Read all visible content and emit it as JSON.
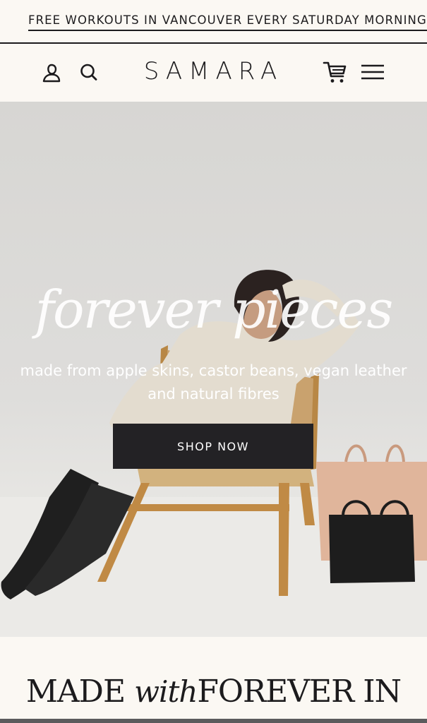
{
  "announcement": {
    "text": "FREE WORKOUTS IN VANCOUVER EVERY SATURDAY MORNING"
  },
  "header": {
    "logo": "SAMARA",
    "icons": {
      "account": "user-icon",
      "search": "search-icon",
      "cart": "cart-icon",
      "menu": "hamburger-menu-icon"
    }
  },
  "hero": {
    "title": "forever pieces",
    "subtitle": "made from apple skins, castor beans, vegan leather and natural fibres",
    "button_label": "SHOP NOW"
  },
  "section": {
    "heading_part1": "MADE",
    "heading_script": "with",
    "heading_part2": "FOREVER IN"
  },
  "colors": {
    "background": "#fbf8f3",
    "text": "#1c1b1d",
    "button": "#232225"
  }
}
